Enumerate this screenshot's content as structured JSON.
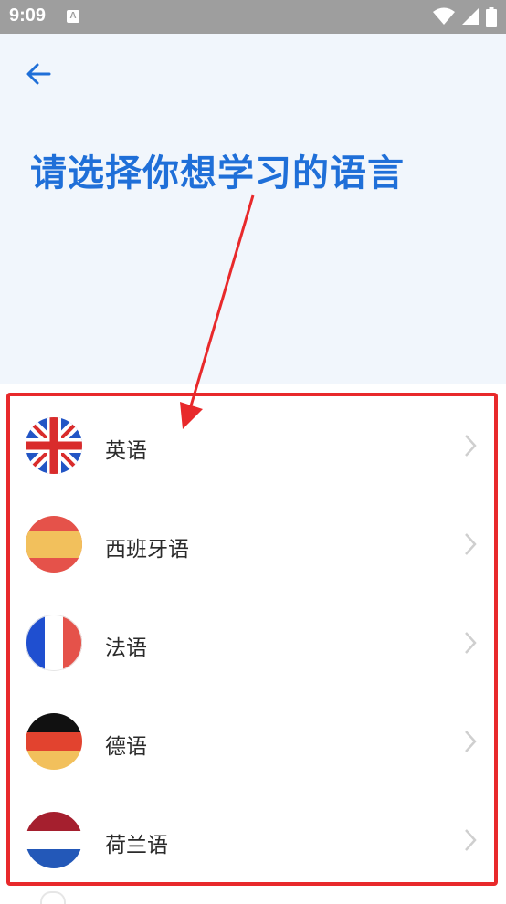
{
  "status_bar": {
    "time": "9:09",
    "notification_icon": "a-notification-icon",
    "icons": [
      "wifi-icon",
      "cellular-signal-icon",
      "battery-icon"
    ]
  },
  "header": {
    "back_icon": "arrow-left-icon",
    "title": "请选择你想学习的语言"
  },
  "languages": [
    {
      "label": "英语",
      "flag": "uk-flag-icon"
    },
    {
      "label": "西班牙语",
      "flag": "spain-flag-icon"
    },
    {
      "label": "法语",
      "flag": "france-flag-icon"
    },
    {
      "label": "德语",
      "flag": "germany-flag-icon"
    },
    {
      "label": "荷兰语",
      "flag": "netherlands-flag-icon"
    }
  ],
  "colors": {
    "accent": "#1f6fd8",
    "highlight_annotation": "#e8292b",
    "hero_background": "#f1f6fc",
    "status_bar": "#9e9e9e"
  }
}
